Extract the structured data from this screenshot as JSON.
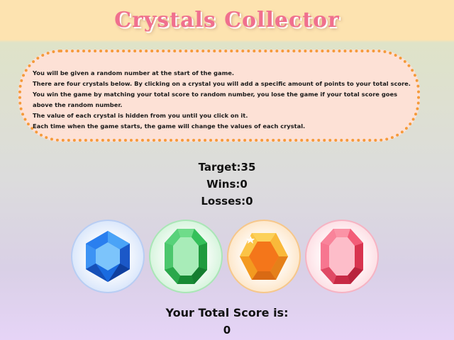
{
  "header": {
    "title": "Crystals Collector"
  },
  "instructions": [
    "You will be given a random number at the start of the game.",
    "There are four crystals below. By clicking on a crystal you will add a specific amount of points to your total score.",
    "You win the game by matching your total score to random number, you lose the game if your total score goes above the random number.",
    "The value of each crystal is hidden from you until you click on it.",
    "Each time when the game starts, the game will change the values of each crystal."
  ],
  "stats": {
    "target": "Target:35",
    "wins": "Wins:0",
    "losses": "Losses:0"
  },
  "crystals": [
    {
      "name": "blue crystal",
      "icon": "blue-hexagon-gem-icon",
      "color": "#1f6fe6"
    },
    {
      "name": "green crystal",
      "icon": "green-emerald-gem-icon",
      "color": "#27b84b"
    },
    {
      "name": "orange crystal",
      "icon": "orange-hexagon-gem-icon",
      "color": "#f4861f"
    },
    {
      "name": "pink crystal",
      "icon": "pink-emerald-gem-icon",
      "color": "#f0587a"
    }
  ],
  "score": {
    "label": "Your Total Score is:",
    "value": "0"
  },
  "colors": {
    "header_bg": "#fde3b0",
    "title": "#f0708e",
    "instructions_bg": "#fde1d6",
    "instructions_border": "#f59a3a"
  }
}
